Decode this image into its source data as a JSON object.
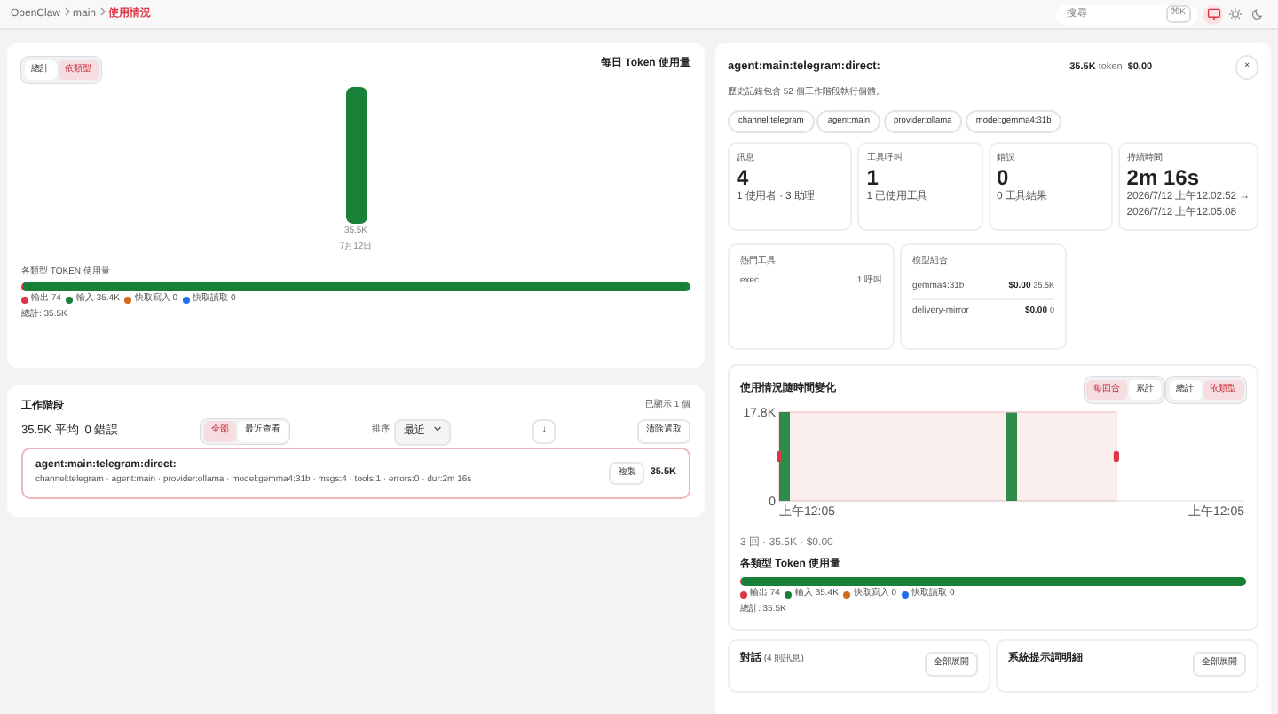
{
  "breadcrumb": [
    {
      "label": "OpenClaw",
      "current": false
    },
    {
      "label": "main",
      "current": false
    },
    {
      "label": "使用情況",
      "current": true
    }
  ],
  "search": {
    "placeholder": "搜尋",
    "shortcut": "⌘K"
  },
  "theme_buttons": [
    {
      "kind": "monitor",
      "selected": true
    },
    {
      "kind": "sun",
      "selected": false
    },
    {
      "kind": "moon",
      "selected": false
    }
  ],
  "daily_usage": {
    "toggle": [
      {
        "label": "總計",
        "selected": false
      },
      {
        "label": "依類型",
        "selected": true
      }
    ],
    "title": "每日 Token 使用量",
    "bars": [
      {
        "value": "35.5K",
        "date": "7月12日"
      }
    ]
  },
  "type_usage": {
    "title": "各類型 TOKEN 使用量",
    "segments": [
      {
        "label": "輸出 74",
        "color": "#dc3545",
        "level": 0.003
      },
      {
        "label": "輸入 35.4K",
        "color": "#198038",
        "level": 0.997
      },
      {
        "label": "快取寫入 0",
        "color": "#d2691e"
      },
      {
        "label": "快取讀取 0",
        "color": "#1f6feb"
      }
    ],
    "total": "總計: 35.5K"
  },
  "sessions": {
    "title": "工作階段",
    "count": "已顯示 1 個",
    "avg": "35.5K 平均",
    "errors": "0 錯誤",
    "filters": [
      {
        "label": "全部",
        "selected": true
      },
      {
        "label": "最近查看",
        "selected": false
      }
    ],
    "sort_label": "排序",
    "sort_value": "最近",
    "direction": "↓",
    "clear": "清除選取",
    "items": [
      {
        "name": "agent:main:telegram:direct:",
        "meta": "channel:telegram · agent:main · provider:ollama · model:gemma4:31b · msgs:4 · tools:1 · errors:0 · dur:2m 16s",
        "copy": "複製",
        "tokens": "35.5K",
        "selected": true
      }
    ]
  },
  "detail": {
    "title": "agent:main:telegram:direct:",
    "tokens": "35.5K",
    "tokens_unit": "token",
    "cost": "$0.00",
    "close": "×",
    "note": "歷史記錄包含 52 個工作階段執行個體。",
    "chips": [
      "channel:telegram",
      "agent:main",
      "provider:ollama",
      "model:gemma4:31b"
    ],
    "stats": [
      {
        "label": "訊息",
        "value": "4",
        "sub": [
          "1 使用者 · 3 助理"
        ]
      },
      {
        "label": "工具呼叫",
        "value": "1",
        "sub": [
          "1 已使用工具"
        ]
      },
      {
        "label": "錯誤",
        "value": "0",
        "sub": [
          "0 工具結果"
        ]
      },
      {
        "label": "持續時間",
        "value": "2m 16s",
        "sub": [
          "2026/7/12 上午12:02:52 →",
          "2026/7/12 上午12:05:08"
        ]
      }
    ],
    "top_tools": {
      "title": "熱門工具",
      "rows": [
        {
          "name": "exec",
          "value": "1 呼叫"
        }
      ]
    },
    "model_mix": {
      "title": "模型組合",
      "rows": [
        {
          "name": "gemma4:31b",
          "cost": "$0.00",
          "tokens": "35.5K"
        },
        {
          "name": "delivery-mirror",
          "cost": "$0.00",
          "tokens": "0"
        }
      ]
    },
    "timeline": {
      "title": "使用情況隨時間變化",
      "mode": [
        {
          "label": "每回合",
          "selected": true
        },
        {
          "label": "累計",
          "selected": false
        }
      ],
      "view": [
        {
          "label": "總計",
          "selected": false
        },
        {
          "label": "依類型",
          "selected": true
        }
      ],
      "chart_data": {
        "type": "bar",
        "categories": [
          "上午12:05",
          null,
          "上午12:05"
        ],
        "values": [
          17.8,
          17.7,
          null
        ],
        "ylim": [
          0,
          17.8
        ],
        "yticks": [
          {
            "value": 0,
            "label": "0"
          },
          {
            "value": 17.8,
            "label": "17.8K"
          }
        ]
      },
      "summary": "3 回 · 35.5K · $0.00",
      "type_title": "各類型 Token 使用量",
      "segments": [
        {
          "label": "輸出 74",
          "color": "#dc3545",
          "level": 0.003
        },
        {
          "label": "輸入 35.4K",
          "color": "#198038",
          "level": 0.997
        },
        {
          "label": "快取寫入 0",
          "color": "#d2691e"
        },
        {
          "label": "快取讀取 0",
          "color": "#1f6feb"
        }
      ],
      "total": "總計: 35.5K"
    },
    "bottom": [
      {
        "title": "對話",
        "sub": "(4 則訊息)",
        "button": "全部展開"
      },
      {
        "title": "系統提示詞明細",
        "button": "全部展開"
      }
    ]
  }
}
